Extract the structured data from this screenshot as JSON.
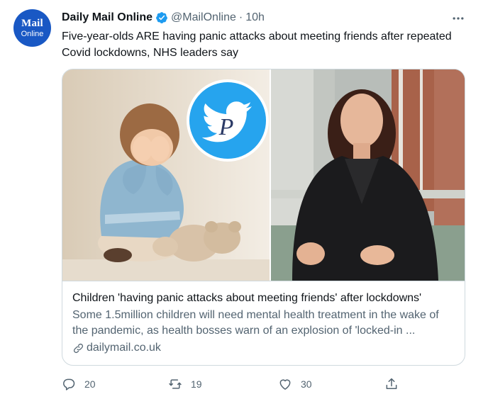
{
  "account": {
    "avatar_line1": "Mail",
    "avatar_line2": "Online",
    "name": "Daily Mail Online",
    "handle": "@MailOnline",
    "separator": "·",
    "time": "10h",
    "verified": true
  },
  "tweet": {
    "text": "Five-year-olds ARE having panic attacks about meeting friends after repeated Covid lockdowns, NHS leaders say"
  },
  "card": {
    "title": "Children 'having panic attacks about meeting friends' after lockdowns'",
    "description": "Some 1.5million children will need mental health treatment in the wake of the pandemic, as health bosses warn of an explosion of 'locked-in ...",
    "domain": "dailymail.co.uk",
    "badge_letter": "P"
  },
  "actions": {
    "reply_count": "20",
    "retweet_count": "19",
    "like_count": "30"
  },
  "colors": {
    "verified": "#1d9bf0",
    "avatar_bg": "#1958c4",
    "badge_bg": "#26a4ee",
    "secondary_text": "#536471"
  }
}
